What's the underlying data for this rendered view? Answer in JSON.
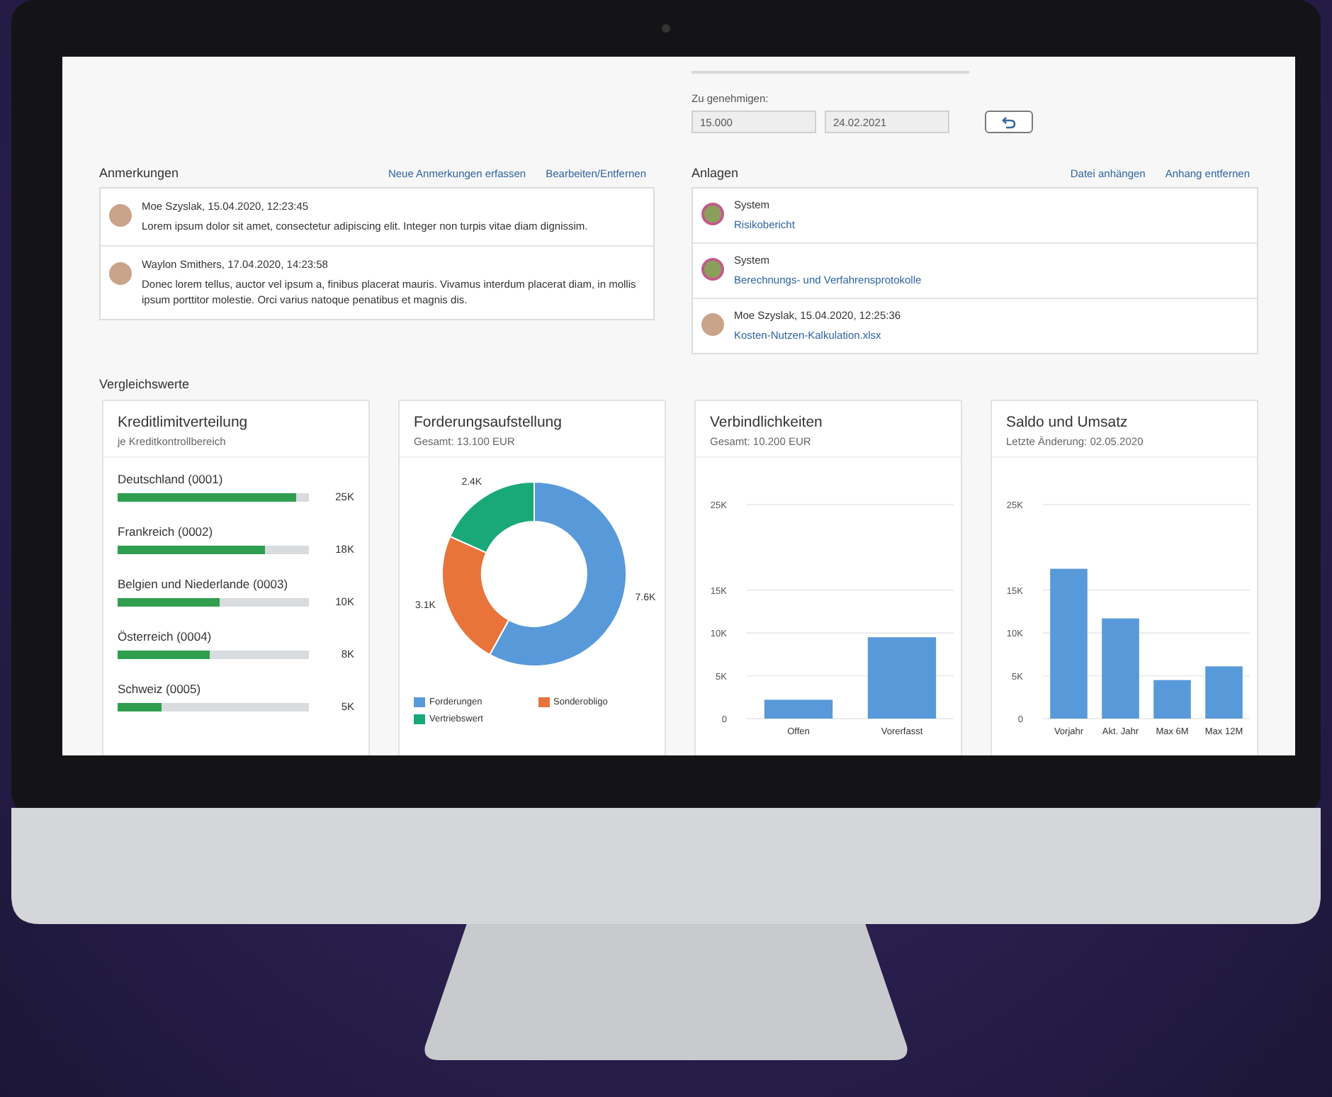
{
  "approval": {
    "label": "Zu genehmigen:",
    "amount": "15.000",
    "date": "24.02.2021"
  },
  "notes": {
    "title": "Anmerkungen",
    "actions": [
      "Neue Anmerkungen erfassen",
      "Bearbeiten/Entfernen"
    ],
    "items": [
      {
        "author": "Moe Szyslak, 15.04.2020, 12:23:45",
        "text": "Lorem ipsum dolor sit amet, consectetur adipiscing elit. Integer non turpis vitae diam dignissim."
      },
      {
        "author": "Waylon Smithers, 17.04.2020, 14:23:58",
        "text": "Donec lorem tellus, auctor vel ipsum a, finibus placerat mauris. Vivamus interdum placerat diam, in mollis ipsum porttitor molestie. Orci varius natoque penatibus et magnis dis."
      }
    ]
  },
  "attachments": {
    "title": "Anlagen",
    "actions": [
      "Datei anhängen",
      "Anhang entfernen"
    ],
    "items": [
      {
        "kind": "system",
        "author": "System",
        "file": "Risikobericht"
      },
      {
        "kind": "system",
        "author": "System",
        "file": "Berechnungs- und Verfahrensprotokolle"
      },
      {
        "kind": "person",
        "author": "Moe Szyslak, 15.04.2020, 12:25:36",
        "file": "Kosten-Nutzen-Kalkulation.xlsx"
      }
    ]
  },
  "comparison": {
    "title": "Vergleichswerte",
    "cards": [
      {
        "kind": "bars",
        "title": "Kreditlimitverteilung",
        "subtitle": "je Kreditkontrollbereich",
        "rows": [
          {
            "name": "Deutschland (0001)",
            "level": 0.93,
            "value": "25K"
          },
          {
            "name": "Frankreich (0002)",
            "level": 0.77,
            "value": "18K"
          },
          {
            "name": "Belgien und Niederlande (0003)",
            "level": 0.53,
            "value": "10K"
          },
          {
            "name": "Österreich (0004)",
            "level": 0.48,
            "value": "8K"
          },
          {
            "name": "Schweiz (0005)",
            "level": 0.23,
            "value": "5K"
          }
        ]
      },
      {
        "kind": "chart",
        "subtitle": "Gesamt: 13.100 EUR",
        "legend": [
          {
            "color": "#5899da"
          },
          {
            "color": "#e8743b"
          },
          {
            "color": "#19a979"
          }
        ],
        "chart_data": {
          "type": "donut",
          "title": "Forderungsaufstellung",
          "categories": [
            "Forderungen",
            "Sonderobligo",
            "Vertriebswert"
          ],
          "values": [
            7.6,
            3.1,
            2.4
          ],
          "value_labels": [
            "7.6K",
            "3.1K",
            "2.4K"
          ]
        }
      },
      {
        "kind": "chart",
        "subtitle": "Gesamt: 10.200 EUR",
        "chart_data": {
          "type": "bar",
          "title": "Verbindlichkeiten",
          "categories": [
            "Offen",
            "Vorerfasst"
          ],
          "series": [
            {
              "color": "#5899da",
              "values": [
                2.2,
                9.5
              ]
            }
          ],
          "ylim": [
            0,
            25
          ],
          "grid": true,
          "yticks": [
            {
              "value": 0,
              "label": "0"
            },
            {
              "value": 5,
              "label": "5K"
            },
            {
              "value": 10,
              "label": "10K"
            },
            {
              "value": 15,
              "label": "15K"
            },
            {
              "value": 25,
              "label": "25K"
            }
          ]
        }
      },
      {
        "kind": "chart",
        "subtitle": "Letzte Änderung: 02.05.2020",
        "chart_data": {
          "type": "bar",
          "title": "Saldo und Umsatz",
          "categories": [
            "Vorjahr",
            "Akt. Jahr",
            "Max 6M",
            "Max 12M"
          ],
          "series": [
            {
              "color": "#5899da",
              "values": [
                17.5,
                11.7,
                4.5,
                6.1
              ]
            }
          ],
          "ylim": [
            0,
            25
          ],
          "grid": true,
          "yticks": [
            {
              "value": 0,
              "label": "0"
            },
            {
              "value": 5,
              "label": "5K"
            },
            {
              "value": 10,
              "label": "10K"
            },
            {
              "value": 15,
              "label": "15K"
            },
            {
              "value": 25,
              "label": "25K"
            }
          ]
        }
      }
    ]
  }
}
